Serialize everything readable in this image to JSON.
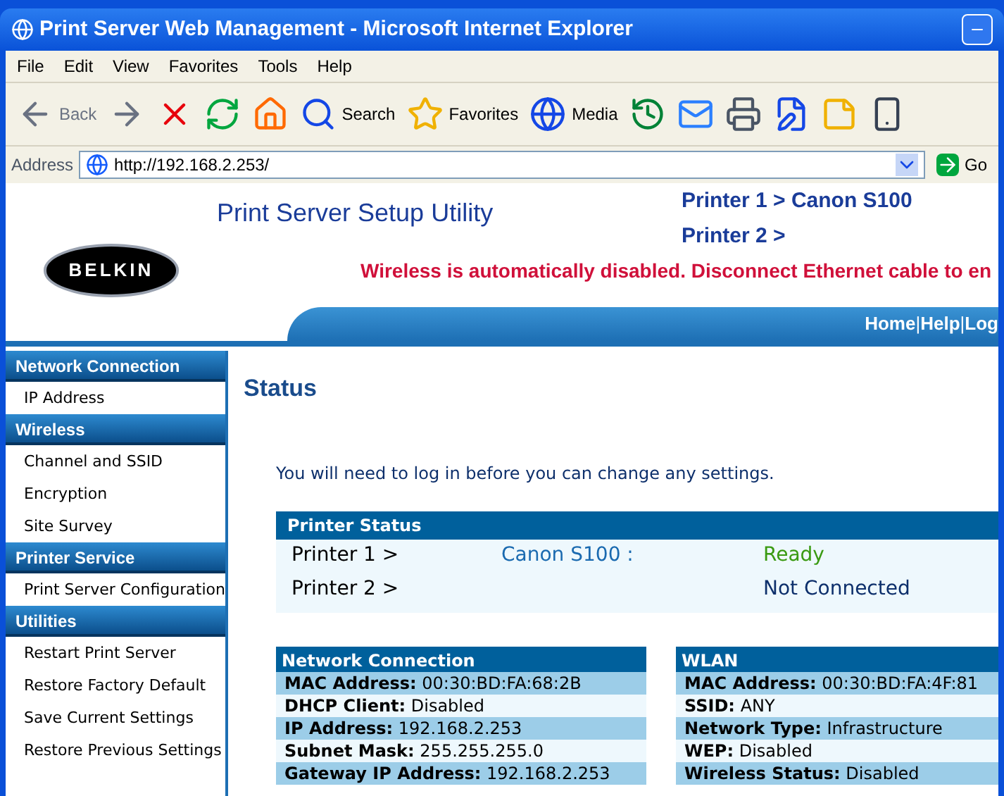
{
  "window": {
    "title": "Print Server Web Management - Microsoft Internet Explorer"
  },
  "menu": [
    "File",
    "Edit",
    "View",
    "Favorites",
    "Tools",
    "Help"
  ],
  "toolbar": [
    {
      "kind": "back",
      "label": "Back"
    },
    {
      "kind": "forward"
    },
    {
      "kind": "stop"
    },
    {
      "kind": "refresh"
    },
    {
      "kind": "home"
    },
    {
      "kind": "search",
      "label": "Search"
    },
    {
      "kind": "favorites",
      "label": "Favorites"
    },
    {
      "kind": "media",
      "label": "Media"
    },
    {
      "kind": "history"
    },
    {
      "kind": "mail"
    },
    {
      "kind": "print"
    },
    {
      "kind": "edit"
    },
    {
      "kind": "note"
    },
    {
      "kind": "device"
    }
  ],
  "address": {
    "label": "Address",
    "url": "http://192.168.2.253/",
    "go": "Go"
  },
  "banner": {
    "logo": "BELKIN",
    "title": "Print Server Setup Utility",
    "printer_links": [
      "Printer 1 > Canon S100",
      "Printer 2 >"
    ],
    "warning": "Wireless is automatically disabled. Disconnect Ethernet cable to en",
    "nav_links": [
      "Home",
      "Help",
      "Log"
    ],
    "separator": "|"
  },
  "sidebar": [
    {
      "title": "Network Connection",
      "items": [
        "IP Address"
      ]
    },
    {
      "title": "Wireless",
      "items": [
        "Channel and SSID",
        "Encryption",
        "Site Survey"
      ]
    },
    {
      "title": "Printer Service",
      "items": [
        "Print Server Configuration"
      ]
    },
    {
      "title": "Utilities",
      "items": [
        "Restart Print Server",
        "Restore Factory Default",
        "Save Current Settings",
        "Restore Previous Settings"
      ]
    }
  ],
  "heading": "Status",
  "notice": "You will need to log in before you can change any settings.",
  "printer_status": {
    "title": "Printer Status",
    "rows": [
      {
        "name": "Printer 1 >",
        "model": "Canon S100 :",
        "status": "Ready",
        "kind": "ready"
      },
      {
        "name": "Printer 2 >",
        "status": "Not Connected",
        "kind": "offline"
      }
    ]
  },
  "network": {
    "title": "Network Connection",
    "rows": [
      {
        "label": "MAC Address:",
        "value": "00:30:BD:FA:68:2B"
      },
      {
        "label": "DHCP Client:",
        "value": "Disabled"
      },
      {
        "label": "IP Address:",
        "value": "192.168.2.253"
      },
      {
        "label": "Subnet Mask:",
        "value": "255.255.255.0"
      },
      {
        "label": "Gateway IP Address:",
        "value": "192.168.2.253"
      }
    ]
  },
  "wlan": {
    "title": "WLAN",
    "rows": [
      {
        "label": "MAC Address:",
        "value": "00:30:BD:FA:4F:81"
      },
      {
        "label": "SSID:",
        "value": "ANY"
      },
      {
        "label": "Network Type:",
        "value": "Infrastructure"
      },
      {
        "label": "WEP:",
        "value": "Disabled"
      },
      {
        "label": "Wireless Status:",
        "value": "Disabled"
      }
    ]
  }
}
